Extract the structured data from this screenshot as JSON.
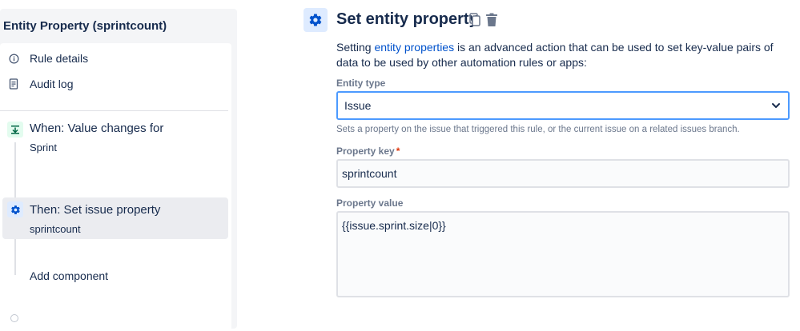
{
  "rule": {
    "title": "Entity Property (sprintcount)"
  },
  "nav": {
    "rule_details": "Rule details",
    "audit_log": "Audit log"
  },
  "components": {
    "trigger": {
      "title": "When: Value changes for",
      "subtitle": "Sprint"
    },
    "action": {
      "title": "Then: Set issue property",
      "subtitle": "sprintcount"
    },
    "add_label": "Add component"
  },
  "editor": {
    "title": "Set entity property",
    "description_prefix": "Setting ",
    "description_link": "entity properties",
    "description_suffix": " is an advanced action that can be used to set key-value pairs of data to be used by other automation rules or apps:",
    "entity_type": {
      "label": "Entity type",
      "value": "Issue",
      "helper": "Sets a property on the issue that triggered this rule, or the current issue on a related issues branch."
    },
    "property_key": {
      "label": "Property key",
      "required_mark": "*",
      "value": "sprintcount"
    },
    "property_value": {
      "label": "Property value",
      "value": "{{issue.sprint.size|0}}"
    }
  },
  "colors": {
    "accent": "#0052cc",
    "focus_border": "#4c9aff",
    "trigger_icon_bg": "#e3fcef",
    "action_icon_bg": "#deebff",
    "required": "#de350b"
  },
  "icons": {
    "rule_details": "info-icon",
    "audit_log": "document-icon",
    "trigger": "trigger-icon",
    "action": "gear-icon",
    "header": "gear-icon",
    "copy": "copy-icon",
    "delete": "trash-icon",
    "dropdown": "chevron-down-icon"
  }
}
